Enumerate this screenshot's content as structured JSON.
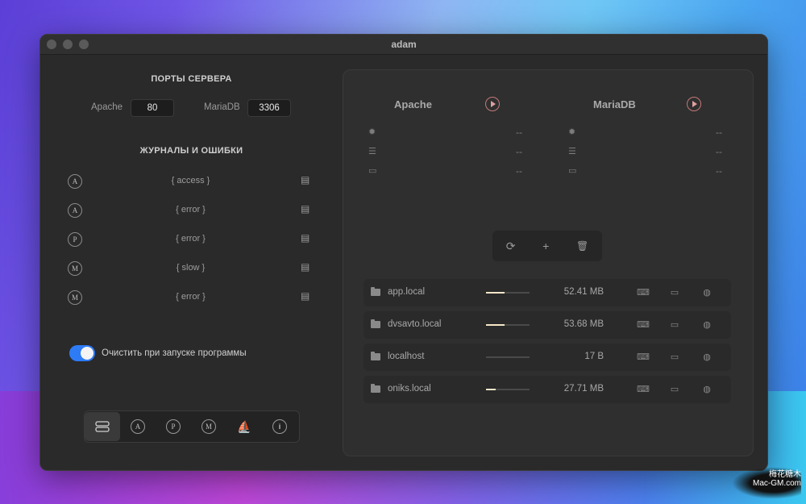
{
  "window": {
    "title": "adam"
  },
  "ports": {
    "heading": "ПОРТЫ СЕРВЕРА",
    "apache_label": "Apache",
    "apache_value": "80",
    "mariadb_label": "MariaDB",
    "mariadb_value": "3306"
  },
  "logs": {
    "heading": "ЖУРНАЛЫ И ОШИБКИ",
    "items": [
      {
        "icon_letter": "A",
        "name": "{ access }"
      },
      {
        "icon_letter": "A",
        "name": "{ error }"
      },
      {
        "icon_letter": "P",
        "name": "{ error }"
      },
      {
        "icon_letter": "M",
        "name": "{ slow }"
      },
      {
        "icon_letter": "M",
        "name": "{ error }"
      }
    ]
  },
  "clear_on_start": {
    "label": "Очистить при запуске программы",
    "checked": true
  },
  "tabs": [
    {
      "icon": "server-icon",
      "active": true
    },
    {
      "icon": "apache-icon",
      "letter": "A"
    },
    {
      "icon": "php-icon",
      "letter": "P"
    },
    {
      "icon": "mariadb-icon",
      "letter": "M"
    },
    {
      "icon": "ship-icon",
      "glyph": "⛵"
    },
    {
      "icon": "info-icon",
      "letter": "i"
    }
  ],
  "services": {
    "apache": {
      "name": "Apache",
      "cpu": "--",
      "processes": "--",
      "memory": "--"
    },
    "mariadb": {
      "name": "MariaDB",
      "cpu": "--",
      "processes": "--",
      "memory": "--"
    }
  },
  "toolbar": {
    "refresh": "⟳",
    "add": "+",
    "delete": "🗑"
  },
  "sites": [
    {
      "name": "app.local",
      "size": "52.41 MB",
      "usage": 0.42
    },
    {
      "name": "dvsavto.local",
      "size": "53.68 MB",
      "usage": 0.43
    },
    {
      "name": "localhost",
      "size": "17 B",
      "usage": 0.0
    },
    {
      "name": "oniks.local",
      "size": "27.71 MB",
      "usage": 0.22
    }
  ],
  "watermark": {
    "line1": "梅花糖木",
    "line2": "Mac-GM.com"
  }
}
